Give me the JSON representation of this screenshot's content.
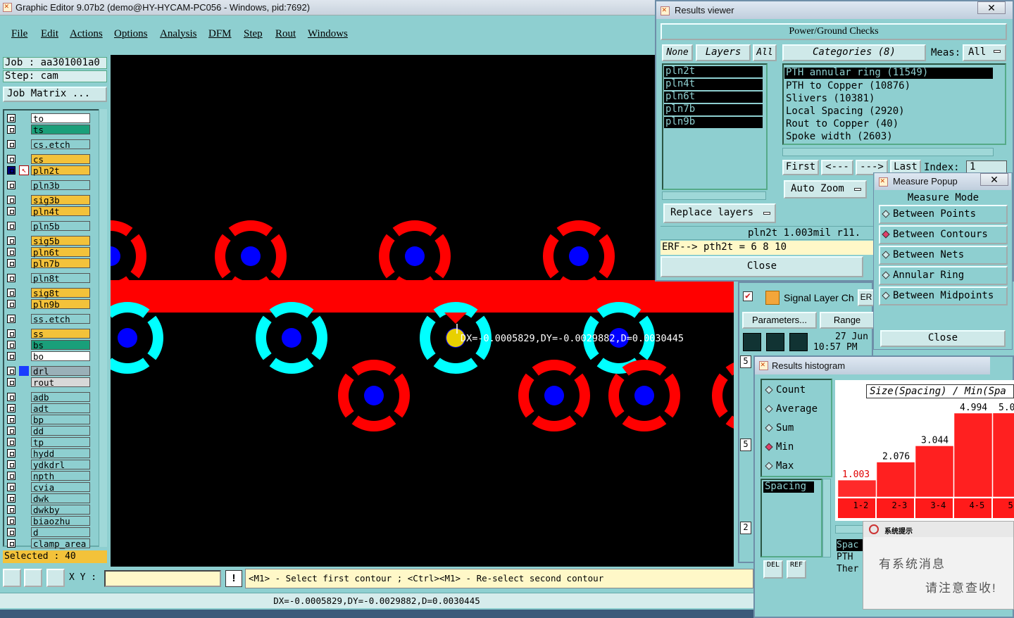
{
  "main_window": {
    "title": "Graphic Editor 9.07b2 (demo@HY-HYCAM-PC056 - Windows, pid:7692)",
    "menu": [
      "File",
      "Edit",
      "Actions",
      "Options",
      "Analysis",
      "DFM",
      "Step",
      "Rout",
      "Windows"
    ],
    "job": "Job : aa301001a0",
    "step": "Step: cam",
    "job_matrix": "Job Matrix ...",
    "selected": "Selected : 40",
    "xy_label": "X Y :",
    "warn": "!",
    "prompt": "<M1> - Select first contour ; <Ctrl><M1> - Re-select second contour",
    "status": "DX=-0.0005829,DY=-0.0029882,D=0.0030445",
    "canvas_measure": "DX=-0.0005829,DY=-0.0029882,D=0.0030445"
  },
  "layers": [
    {
      "name": "to",
      "color": "#ffffff"
    },
    {
      "name": "ts",
      "color": "#1a9f7a"
    },
    {
      "name": "cs.etch",
      "color": "#8ecfd0"
    },
    {
      "name": "cs",
      "color": "#f3c23a"
    },
    {
      "name": "pln2t",
      "color": "#f3c23a"
    },
    {
      "name": "pln3b",
      "color": "#8ecfd0"
    },
    {
      "name": "sig3b",
      "color": "#f3c23a"
    },
    {
      "name": "pln4t",
      "color": "#f3c23a"
    },
    {
      "name": "pln5b",
      "color": "#8ecfd0"
    },
    {
      "name": "sig5b",
      "color": "#f3c23a"
    },
    {
      "name": "pln6t",
      "color": "#f3c23a"
    },
    {
      "name": "pln7b",
      "color": "#f3c23a"
    },
    {
      "name": "pln8t",
      "color": "#8ecfd0"
    },
    {
      "name": "sig8t",
      "color": "#f3c23a"
    },
    {
      "name": "pln9b",
      "color": "#f3c23a"
    },
    {
      "name": "ss.etch",
      "color": "#8ecfd0"
    },
    {
      "name": "ss",
      "color": "#f3c23a"
    },
    {
      "name": "bs",
      "color": "#1a9f7a"
    },
    {
      "name": "bo",
      "color": "#ffffff"
    },
    {
      "name": "drl",
      "color": "#9ab0b8"
    },
    {
      "name": "rout",
      "color": "#d8d8d8"
    },
    {
      "name": "adb",
      "color": "#8ecfd0"
    },
    {
      "name": "adt",
      "color": "#8ecfd0"
    },
    {
      "name": "bp",
      "color": "#8ecfd0"
    },
    {
      "name": "dd",
      "color": "#8ecfd0"
    },
    {
      "name": "tp",
      "color": "#8ecfd0"
    },
    {
      "name": "hydd",
      "color": "#8ecfd0"
    },
    {
      "name": "ydkdrl",
      "color": "#8ecfd0"
    },
    {
      "name": "npth",
      "color": "#8ecfd0"
    },
    {
      "name": "cvia",
      "color": "#8ecfd0"
    },
    {
      "name": "dwk",
      "color": "#8ecfd0"
    },
    {
      "name": "dwkby",
      "color": "#8ecfd0"
    },
    {
      "name": "biaozhu",
      "color": "#8ecfd0"
    },
    {
      "name": "d",
      "color": "#8ecfd0"
    },
    {
      "name": "clamp_area",
      "color": "#8ecfd0"
    }
  ],
  "results_viewer": {
    "title": "Results viewer",
    "header": "Power/Ground Checks",
    "none": "None",
    "layers_btn": "Layers",
    "all": "All",
    "categories": "Categories (8)",
    "meas": "Meas:",
    "meas_value": "All",
    "layer_list": [
      "pln2t",
      "pln4t",
      "pln6t",
      "pln7b",
      "pln9b"
    ],
    "category_list": [
      "PTH annular ring (11549)",
      "PTH to Copper (10876)",
      "Slivers (10381)",
      "Local Spacing (2920)",
      "Rout to Copper (40)",
      "Spoke width (2603)"
    ],
    "first": "First",
    "prev": "<---",
    "next": "--->",
    "last": "Last",
    "index": "Index:",
    "index_value": "1",
    "auto_zoom": "Auto Zoom",
    "replace_layers": "Replace layers",
    "result_line": "pln2t 1.003mil  r11.",
    "erf_line": "ERF--> pth2t = 6 8 10",
    "close": "Close"
  },
  "measure_popup": {
    "title": "Measure Popup",
    "mode_header": "Measure Mode",
    "modes": [
      "Between Points",
      "Between Contours",
      "Between Nets",
      "Annular Ring",
      "Between Midpoints"
    ],
    "selected_mode": "Between Contours",
    "close": "Close"
  },
  "signal_checks": {
    "title": "Signal Layer Ch",
    "er": "ER",
    "parameters": "Parameters...",
    "ranges": "Range",
    "date": "27 Jun",
    "time": "10:57 PM",
    "side_numbers": [
      "5",
      "5",
      "2"
    ]
  },
  "histogram": {
    "title": "Results histogram",
    "options": [
      "Count",
      "Average",
      "Sum",
      "Min",
      "Max"
    ],
    "selected_option": "Min",
    "list_item": "Spacing",
    "del": "DEL",
    "ref": "REF",
    "chart_title": "Size(Spacing) / Min(Spa",
    "side_list": [
      "Spac",
      "PTH",
      "Ther"
    ]
  },
  "chart_data": {
    "type": "bar",
    "title": "Size(Spacing) / Min(Spa",
    "categories": [
      "1-2",
      "2-3",
      "3-4",
      "4-5",
      "5-"
    ],
    "values": [
      1.003,
      2.076,
      3.044,
      4.994,
      5.0
    ],
    "value_labels": [
      "1.003",
      "2.076",
      "3.044",
      "4.994",
      "5.0"
    ],
    "ylim": [
      0,
      6
    ]
  },
  "notification": {
    "title": "系统提示",
    "line1": "有系统消息",
    "line2": "请注意查收!"
  },
  "colors": {
    "panel": "#8ecfd0",
    "canvas": "#000000",
    "pad_red": "#ff0000",
    "pad_cyan": "#00ffff",
    "via_blue": "#0000ff",
    "selected_yellow": "#e8d000"
  }
}
